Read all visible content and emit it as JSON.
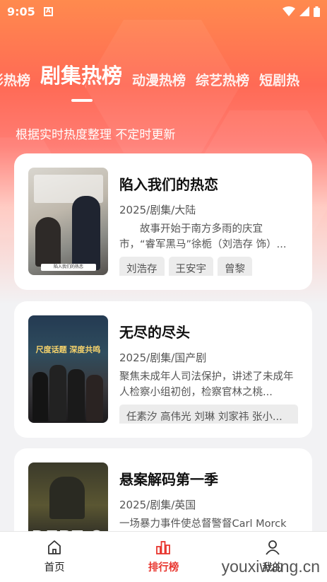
{
  "status_bar": {
    "time": "9:05",
    "notification_icon": "a-letter-icon",
    "icons": [
      "wifi-icon",
      "signal-icon",
      "battery-icon"
    ]
  },
  "tabs": [
    {
      "label": "影热榜",
      "active": false
    },
    {
      "label": "剧集热榜",
      "active": true
    },
    {
      "label": "动漫热榜",
      "active": false
    },
    {
      "label": "综艺热榜",
      "active": false
    },
    {
      "label": "短剧热",
      "active": false
    }
  ],
  "subtitle": "根据实时热度整理 不定时更新",
  "cards": [
    {
      "title": "陷入我们的热恋",
      "meta": "2025/剧集/大陆",
      "desc": "　　故事开始于南方多雨的庆宜市，“睿军黑马”徐栀（刘浩存 饰）...",
      "tags": [
        "刘浩存",
        "王安宇",
        "曾黎"
      ],
      "poster_caption": "陷入我们的热恋"
    },
    {
      "title": "无尽的尽头",
      "meta": "2025/剧集/国产剧",
      "desc": "聚焦未成年人司法保护，讲述了未成年人检察小组初创，检察官林之桃...",
      "tags": [
        "任素汐 高伟光 刘琳 刘家祎 张小..."
      ],
      "poster_caption": "尺度话题 深度共鸣"
    },
    {
      "title": "悬案解码第一季",
      "meta": "2025/剧集/英国",
      "desc": "一场暴力事件使总督警督Carl Morck（马修·麦克迪 饰）的人生天翻...",
      "tags": [],
      "poster_caption": "DEPT Q"
    }
  ],
  "bottom_nav": [
    {
      "label": "首页",
      "icon": "home-icon",
      "active": false
    },
    {
      "label": "排行榜",
      "icon": "bar-chart-icon",
      "active": true
    },
    {
      "label": "我的",
      "icon": "profile-icon",
      "active": false
    }
  ],
  "watermark": "youxiwang.cn",
  "colors": {
    "accent": "#e8352e",
    "hero_top": "#ff8a4e",
    "hero_mid": "#ff6a55"
  }
}
